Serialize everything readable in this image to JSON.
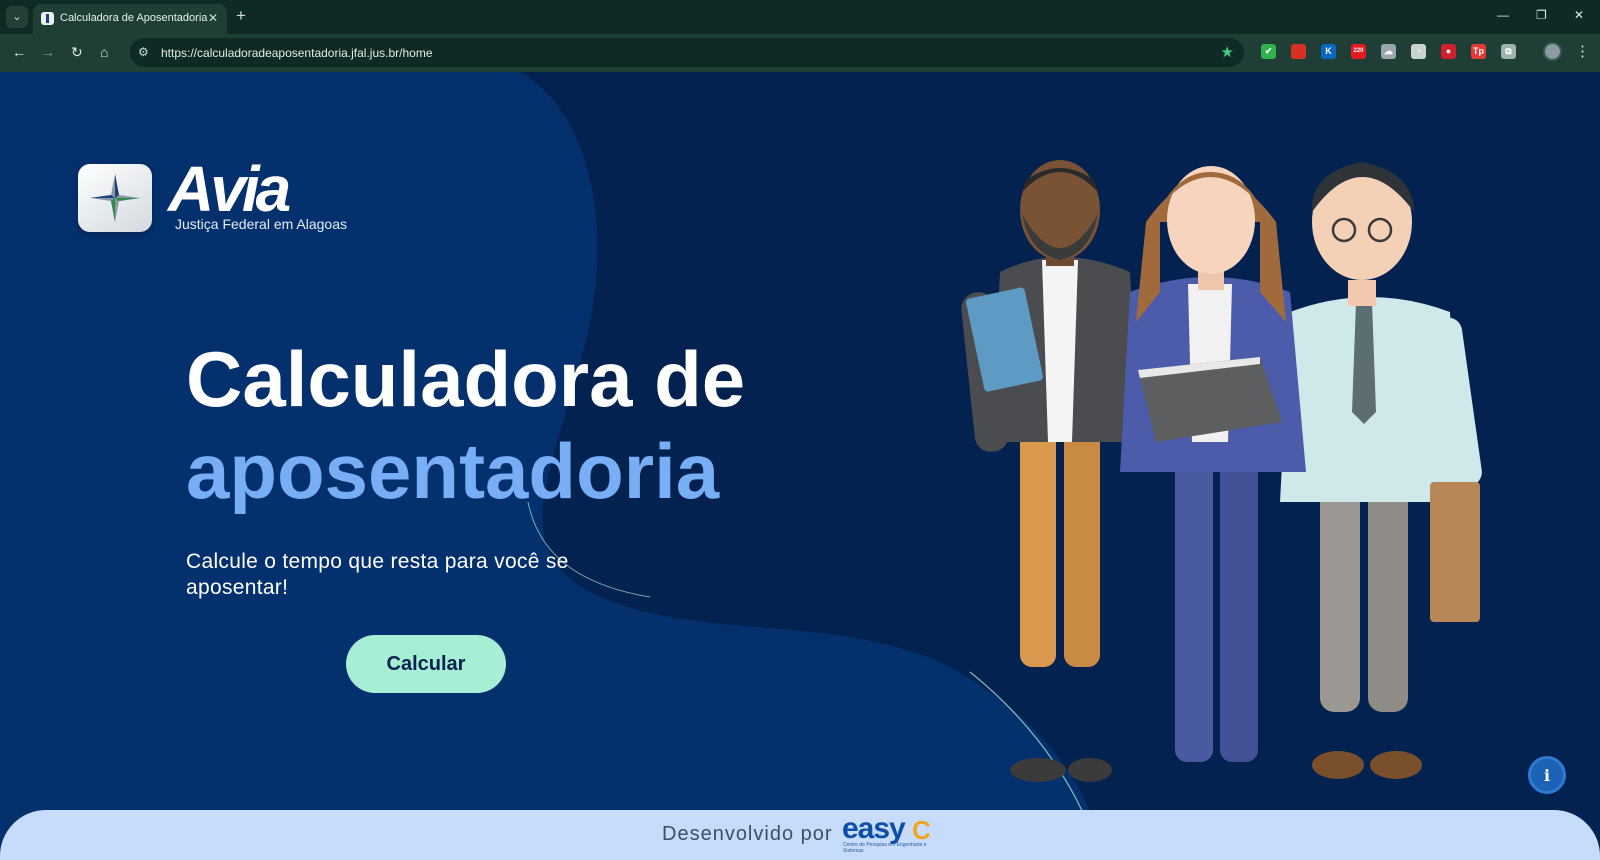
{
  "browser": {
    "tab_title": "Calculadora de Aposentadoria",
    "url": "https://calculadoradeaposentadoria.jfal.jus.br/home",
    "extensions": [
      {
        "icon": "check-extension-icon",
        "color": "#2fb24a",
        "glyph": "✔"
      },
      {
        "icon": "bookmark-extension-icon",
        "color": "#d93025",
        "glyph": ""
      },
      {
        "icon": "k-extension-icon",
        "color": "#0b66c3",
        "glyph": "K"
      },
      {
        "icon": "calendar-extension-icon",
        "color": "#e51b23",
        "glyph": "220"
      },
      {
        "icon": "cloud-extension-icon",
        "color": "#9aa5ad",
        "glyph": "☁"
      },
      {
        "icon": "gauge-extension-icon",
        "color": "#c9d3cf",
        "glyph": "◔"
      },
      {
        "icon": "shield-extension-icon",
        "color": "#d0202f",
        "glyph": "●"
      },
      {
        "icon": "tp-extension-icon",
        "color": "#e53935",
        "glyph": "Tp"
      },
      {
        "icon": "puzzle-extension-icon",
        "color": "#9fb3ad",
        "glyph": "⧉"
      }
    ]
  },
  "logo": {
    "word": "Avia",
    "subtitle": "Justiça Federal em Alagoas"
  },
  "hero": {
    "title_line1": "Calculadora de",
    "title_line2": "aposentadoria",
    "subtitle": "Calcule o tempo que resta para você se aposentar!",
    "cta_label": "Calcular"
  },
  "footer": {
    "text": "Desenvolvido por",
    "brand": "easy",
    "brand_mark": "C",
    "brand_sub": "Centro de Pesquisa em Engenharia e Sistemas"
  },
  "colors": {
    "page_bg": "#03224f",
    "blob": "#05306e",
    "accent_text": "#78aef5",
    "cta_bg": "#a6eed4",
    "footer_bg": "#c7dcfb"
  }
}
